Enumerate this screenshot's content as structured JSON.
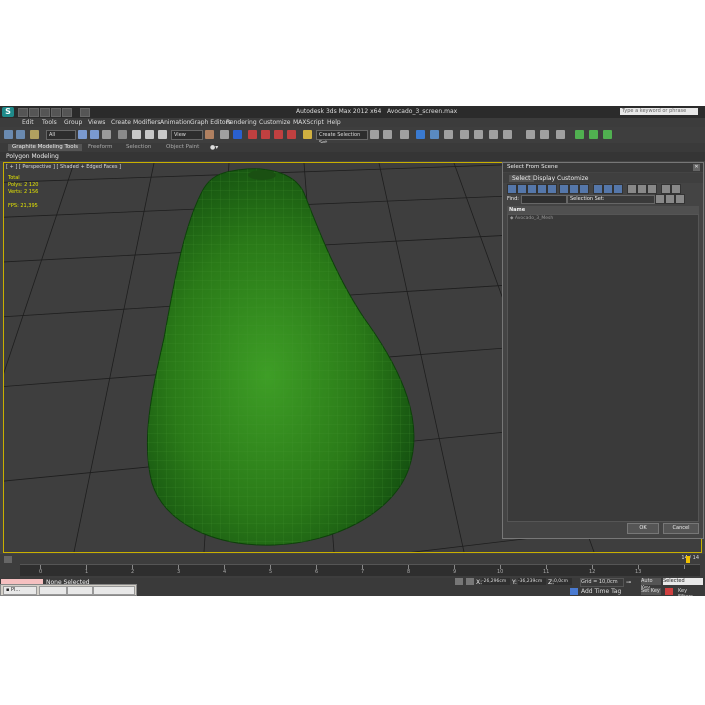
{
  "window": {
    "title": "Autodesk 3ds Max 2012 x64",
    "file": "Avocado_3_screen.max",
    "search_placeholder": "Type a keyword or phrase"
  },
  "menubar": [
    "Edit",
    "Tools",
    "Group",
    "Views",
    "Create",
    "Modifiers",
    "Animation",
    "Graph Editors",
    "Rendering",
    "Customize",
    "MAXScript",
    "Help"
  ],
  "toolbar": {
    "selection_filter": "All",
    "reference_coord": "View",
    "named_selection": "Create Selection Set"
  },
  "ribbon": {
    "tabs": [
      "Graphite Modeling Tools",
      "Freeform",
      "Selection",
      "Object Paint"
    ],
    "panel": "Polygon Modeling"
  },
  "viewport": {
    "label": "[ + ] [ Perspective ] [ Shaded + Edged Faces ]",
    "stats": {
      "total_label": "Total",
      "polys_label": "Polys:",
      "polys": "2 120",
      "verts_label": "Verts:",
      "verts": "2 156",
      "fps_label": "FPS:",
      "fps": "21,395"
    }
  },
  "dialog": {
    "title": "Select From Scene",
    "menu": [
      "Select",
      "Display",
      "Customize"
    ],
    "find_label": "Find:",
    "selection_set": "Selection Set:",
    "column_header": "Name",
    "items": [
      "Avocado_3_Mesh"
    ],
    "ok": "OK",
    "cancel": "Cancel"
  },
  "timeline": {
    "frames": "14 / 14",
    "ticks": [
      "0",
      "1",
      "2",
      "3",
      "4",
      "5",
      "6",
      "7",
      "8",
      "9",
      "10",
      "11",
      "12",
      "13",
      "14"
    ]
  },
  "status": {
    "selected": "None Selected",
    "x_label": "X:",
    "x": "-26,296cm",
    "y_label": "Y:",
    "y": "-36,239cm",
    "z_label": "Z:",
    "z": "0,0cm",
    "grid": "Grid = 10,0cm",
    "auto_key": "Auto Key",
    "key_mode": "Selected",
    "set_key": "Set Key",
    "key_filters": "Key Filters...",
    "add_time_tag": "Add Time Tag"
  },
  "taskbar": [
    "Pl..."
  ],
  "colors": {
    "viewport_border": "#c9b000",
    "stats_text": "#e6e600",
    "avocado_green": "#2f8a1e",
    "brand": "#1f8a8a"
  }
}
